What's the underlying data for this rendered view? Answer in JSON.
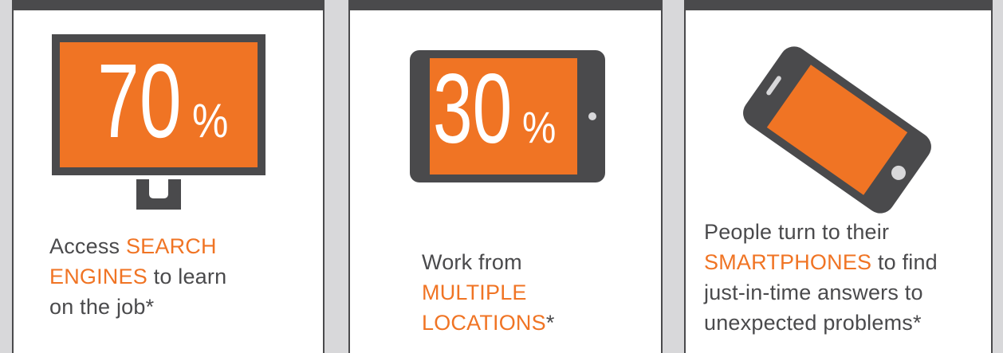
{
  "colors": {
    "accent": "#f07424",
    "dark": "#4a4a4c",
    "background": "#d8d8da"
  },
  "cards": [
    {
      "icon": "desktop-monitor-icon",
      "stat_number": "70",
      "stat_unit": "%",
      "text_before": "Access ",
      "highlight_1": "SEARCH",
      "highlight_2": "ENGINES",
      "text_after_1": " to learn",
      "text_after_2": "on the job*"
    },
    {
      "icon": "tablet-icon",
      "stat_number": "30",
      "stat_unit": "%",
      "text_before": "Work from",
      "highlight_1": "MULTIPLE",
      "highlight_2": "LOCATIONS",
      "text_after": "*"
    },
    {
      "icon": "smartphone-icon",
      "text_line_1": "People turn to their",
      "highlight": "SMARTPHONES",
      "text_after_highlight": " to find",
      "text_line_3": "just-in-time answers to",
      "text_line_4": "unexpected problems*"
    }
  ]
}
